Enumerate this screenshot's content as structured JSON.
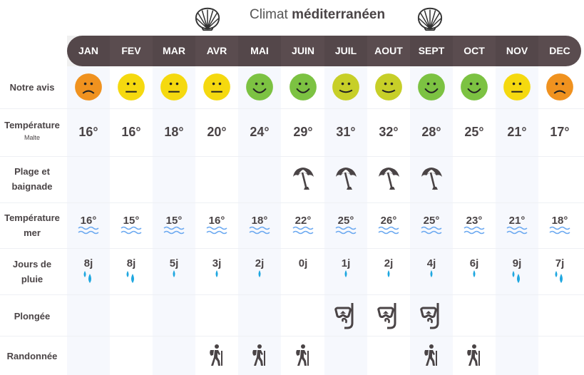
{
  "title": {
    "prefix": "Climat",
    "bold": "méditerranéen",
    "left_icon": "shell-icon",
    "right_icon": "shell-icon"
  },
  "months": [
    "JAN",
    "FEV",
    "MAR",
    "AVR",
    "MAI",
    "JUIN",
    "JUIL",
    "AOUT",
    "SEPT",
    "OCT",
    "NOV",
    "DEC"
  ],
  "rows": {
    "avis": {
      "label": "Notre avis"
    },
    "temperature": {
      "label": "Température",
      "sublabel": "Malte"
    },
    "plage": {
      "label_line1": "Plage et",
      "label_line2": "baignade"
    },
    "mer": {
      "label_line1": "Température",
      "label_line2": "mer"
    },
    "pluie": {
      "label_line1": "Jours de",
      "label_line2": "pluie"
    },
    "plongee": {
      "label": "Plongée"
    },
    "randonnee": {
      "label": "Randonnée"
    }
  },
  "ratings": [
    "bad",
    "neutral",
    "neutral",
    "neutral",
    "good",
    "good",
    "ok",
    "ok",
    "good",
    "good",
    "neutral",
    "bad"
  ],
  "rating_colors": {
    "bad": "#f0921f",
    "neutral": "#f5d90f",
    "ok": "#c7cf28",
    "good": "#7cc242"
  },
  "air_temps": [
    "16°",
    "16°",
    "18°",
    "20°",
    "24°",
    "29°",
    "31°",
    "32°",
    "28°",
    "25°",
    "21°",
    "17°"
  ],
  "beach": [
    false,
    false,
    false,
    false,
    false,
    true,
    true,
    true,
    true,
    false,
    false,
    false
  ],
  "sea_temps": [
    "16°",
    "15°",
    "15°",
    "16°",
    "18°",
    "22°",
    "25°",
    "26°",
    "25°",
    "23°",
    "21°",
    "18°"
  ],
  "rain_days": [
    "8j",
    "8j",
    "5j",
    "3j",
    "2j",
    "0j",
    "1j",
    "2j",
    "4j",
    "6j",
    "9j",
    "7j"
  ],
  "rain_drops": [
    2,
    2,
    1,
    1,
    1,
    0,
    1,
    1,
    1,
    1,
    2,
    2
  ],
  "diving": [
    false,
    false,
    false,
    false,
    false,
    false,
    true,
    true,
    true,
    false,
    false,
    false
  ],
  "hiking": [
    false,
    false,
    false,
    true,
    true,
    true,
    false,
    false,
    true,
    true,
    false,
    false
  ],
  "colors": {
    "header_bg": "#5a4c4f",
    "text": "#4a4446",
    "wave": "#6aa8f0",
    "drop": "#1ea7e0",
    "icon": "#4a4446",
    "column_shade": "#f6f8fd"
  }
}
